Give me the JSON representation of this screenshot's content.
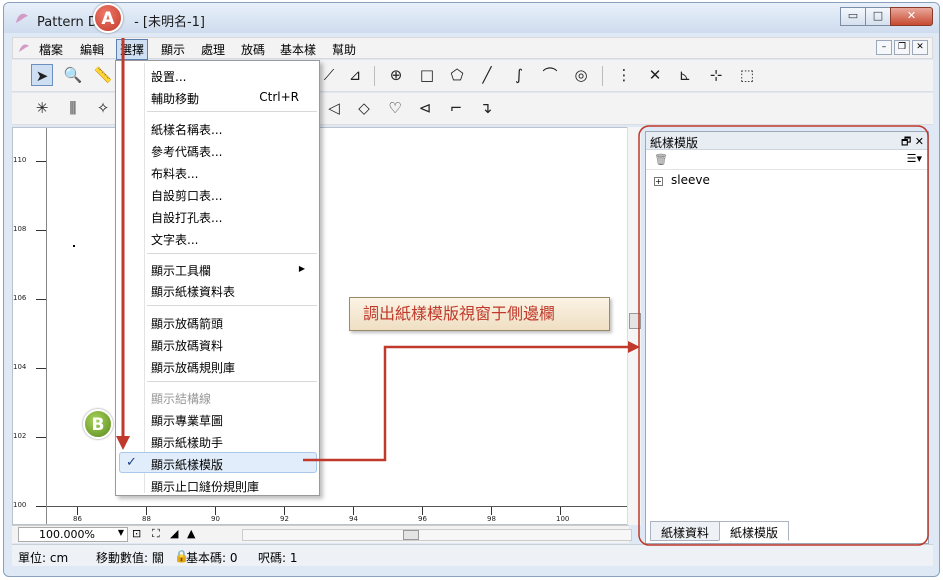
{
  "window": {
    "title": "Pattern D",
    "doc_title": "- [未明名-1]",
    "minimize_label": "▭",
    "maximize_label": "□",
    "close_label": "✕"
  },
  "menubar": {
    "items": [
      "檔案",
      "編輯",
      "選擇",
      "顯示",
      "處理",
      "放碼",
      "基本樣",
      "幫助"
    ],
    "active_index": 2
  },
  "dropdown": {
    "items": [
      {
        "label": "設置...",
        "shortcut": ""
      },
      {
        "label": "輔助移動",
        "shortcut": "Ctrl+R"
      },
      {
        "label": "紙樣名稱表..."
      },
      {
        "label": "參考代碼表..."
      },
      {
        "label": "布料表..."
      },
      {
        "label": "自設剪口表..."
      },
      {
        "label": "自設打孔表..."
      },
      {
        "label": "文字表..."
      },
      {
        "label": "顯示工具欄"
      },
      {
        "label": "顯示紙樣資料表"
      },
      {
        "label": "顯示放碼箭頭"
      },
      {
        "label": "顯示放碼資料"
      },
      {
        "label": "顯示放碼規則庫"
      },
      {
        "label": "顯示結構線"
      },
      {
        "label": "顯示專業草圖"
      },
      {
        "label": "顯示紙樣助手"
      },
      {
        "label": "顯示紙樣模版"
      },
      {
        "label": "顯示止口縫份規則庫"
      }
    ],
    "check_mark": "✓"
  },
  "ruler": {
    "vertical": [
      "110",
      "108",
      "106",
      "104",
      "102",
      "100"
    ],
    "horizontal": [
      "86",
      "88",
      "90",
      "92",
      "94",
      "96",
      "98",
      "100"
    ]
  },
  "zoom": "100.000%",
  "statusbar": {
    "unit": "單位: cm",
    "move_value": "移動數值: 關",
    "base_code": "基本碼: 0",
    "yard": "呎碼: 1"
  },
  "panel": {
    "title": "紙樣模版",
    "tree_item": "sleeve",
    "tabs": [
      "紙樣資料",
      "紙樣模版"
    ],
    "active_tab": 1
  },
  "annotations": {
    "callout": "調出紙樣模版視窗于側邊欄",
    "badge_a": "A",
    "badge_b": "B",
    "accent_color": "#c0392b",
    "highlight_color": "#e1edfb"
  }
}
